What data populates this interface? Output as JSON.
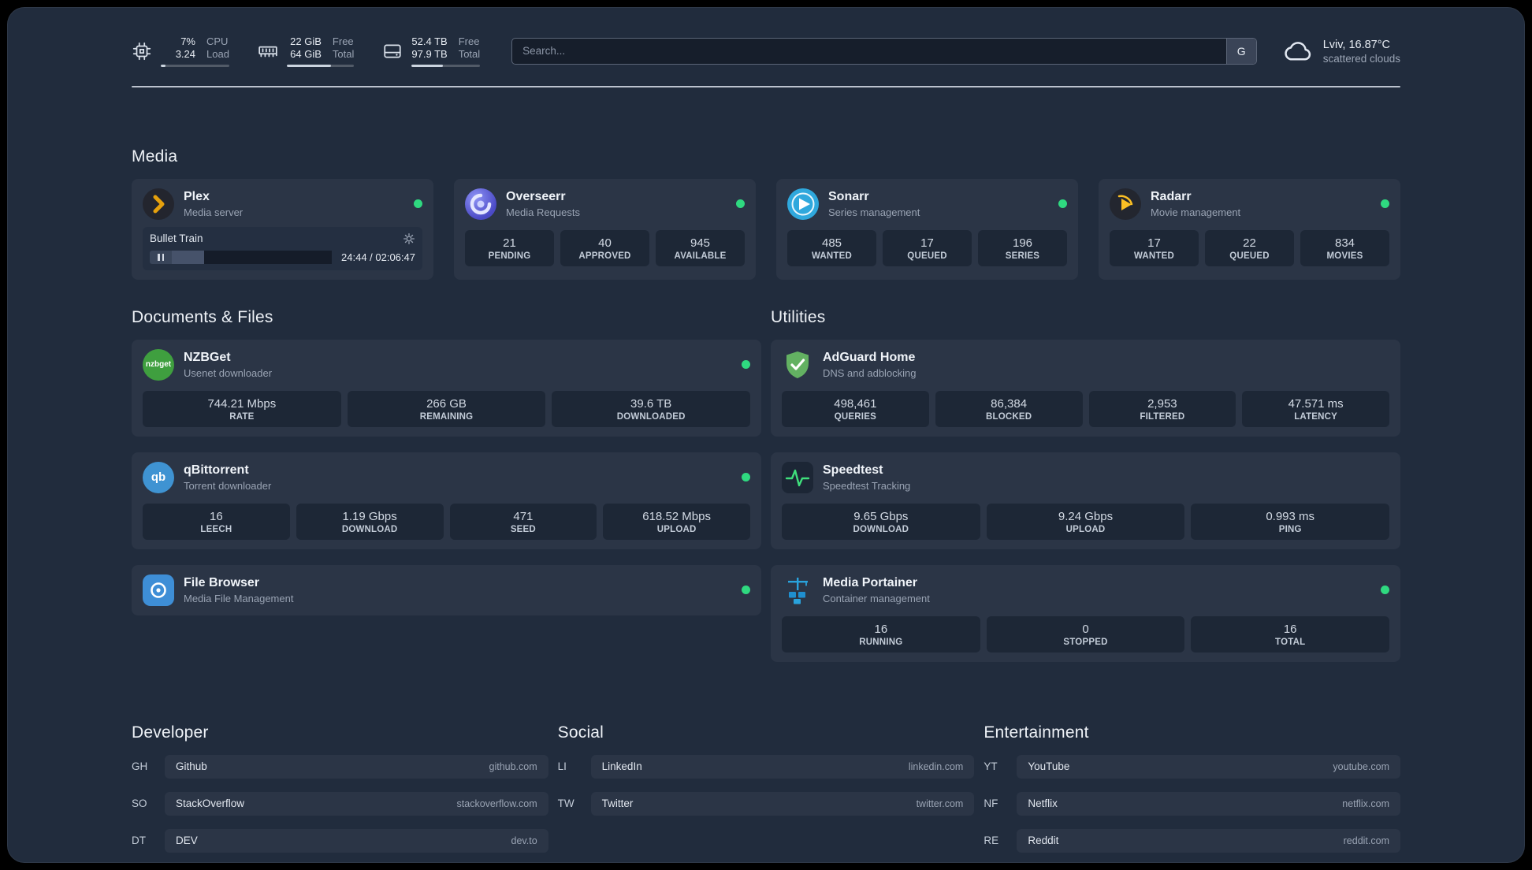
{
  "topbar": {
    "resources": [
      {
        "value_top": "7%",
        "value_bottom": "3.24",
        "label_top": "CPU",
        "label_bottom": "Load",
        "progress_pct": 7
      },
      {
        "value_top": "22 GiB",
        "value_bottom": "64 GiB",
        "label_top": "Free",
        "label_bottom": "Total",
        "progress_pct": 66
      },
      {
        "value_top": "52.4 TB",
        "value_bottom": "97.9 TB",
        "label_top": "Free",
        "label_bottom": "Total",
        "progress_pct": 46
      }
    ],
    "search": {
      "placeholder": "Search...",
      "provider": "G"
    },
    "weather": {
      "location": "Lviv, 16.87°C",
      "condition": "scattered clouds"
    }
  },
  "media": {
    "heading": "Media",
    "plex": {
      "title": "Plex",
      "subtitle": "Media server",
      "now_playing": "Bullet Train",
      "time": "24:44 / 02:06:47",
      "progress_pct": 20
    },
    "overseerr": {
      "title": "Overseerr",
      "subtitle": "Media Requests",
      "stats": [
        {
          "value": "21",
          "label": "PENDING"
        },
        {
          "value": "40",
          "label": "APPROVED"
        },
        {
          "value": "945",
          "label": "AVAILABLE"
        }
      ]
    },
    "sonarr": {
      "title": "Sonarr",
      "subtitle": "Series management",
      "stats": [
        {
          "value": "485",
          "label": "WANTED"
        },
        {
          "value": "17",
          "label": "QUEUED"
        },
        {
          "value": "196",
          "label": "SERIES"
        }
      ]
    },
    "radarr": {
      "title": "Radarr",
      "subtitle": "Movie management",
      "stats": [
        {
          "value": "17",
          "label": "WANTED"
        },
        {
          "value": "22",
          "label": "QUEUED"
        },
        {
          "value": "834",
          "label": "MOVIES"
        }
      ]
    }
  },
  "documents": {
    "heading": "Documents & Files",
    "nzbget": {
      "title": "NZBGet",
      "subtitle": "Usenet downloader",
      "icon_text": "nzbget",
      "stats": [
        {
          "value": "744.21 Mbps",
          "label": "RATE"
        },
        {
          "value": "266 GB",
          "label": "REMAINING"
        },
        {
          "value": "39.6 TB",
          "label": "DOWNLOADED"
        }
      ]
    },
    "qbittorrent": {
      "title": "qBittorrent",
      "subtitle": "Torrent downloader",
      "icon_text": "qb",
      "stats": [
        {
          "value": "16",
          "label": "LEECH"
        },
        {
          "value": "1.19 Gbps",
          "label": "DOWNLOAD"
        },
        {
          "value": "471",
          "label": "SEED"
        },
        {
          "value": "618.52 Mbps",
          "label": "UPLOAD"
        }
      ]
    },
    "filebrowser": {
      "title": "File Browser",
      "subtitle": "Media File Management"
    }
  },
  "utilities": {
    "heading": "Utilities",
    "adguard": {
      "title": "AdGuard Home",
      "subtitle": "DNS and adblocking",
      "stats": [
        {
          "value": "498,461",
          "label": "QUERIES"
        },
        {
          "value": "86,384",
          "label": "BLOCKED"
        },
        {
          "value": "2,953",
          "label": "FILTERED"
        },
        {
          "value": "47.571 ms",
          "label": "LATENCY"
        }
      ]
    },
    "speedtest": {
      "title": "Speedtest",
      "subtitle": "Speedtest Tracking",
      "stats": [
        {
          "value": "9.65 Gbps",
          "label": "DOWNLOAD"
        },
        {
          "value": "9.24 Gbps",
          "label": "UPLOAD"
        },
        {
          "value": "0.993 ms",
          "label": "PING"
        }
      ]
    },
    "portainer": {
      "title": "Media Portainer",
      "subtitle": "Container management",
      "stats": [
        {
          "value": "16",
          "label": "RUNNING"
        },
        {
          "value": "0",
          "label": "STOPPED"
        },
        {
          "value": "16",
          "label": "TOTAL"
        }
      ]
    }
  },
  "bookmarks": {
    "developer": {
      "heading": "Developer",
      "items": [
        {
          "abbr": "GH",
          "name": "Github",
          "url": "github.com"
        },
        {
          "abbr": "SO",
          "name": "StackOverflow",
          "url": "stackoverflow.com"
        },
        {
          "abbr": "DT",
          "name": "DEV",
          "url": "dev.to"
        }
      ]
    },
    "social": {
      "heading": "Social",
      "items": [
        {
          "abbr": "LI",
          "name": "LinkedIn",
          "url": "linkedin.com"
        },
        {
          "abbr": "TW",
          "name": "Twitter",
          "url": "twitter.com"
        }
      ]
    },
    "entertainment": {
      "heading": "Entertainment",
      "items": [
        {
          "abbr": "YT",
          "name": "YouTube",
          "url": "youtube.com"
        },
        {
          "abbr": "NF",
          "name": "Netflix",
          "url": "netflix.com"
        },
        {
          "abbr": "RE",
          "name": "Reddit",
          "url": "reddit.com"
        }
      ]
    }
  }
}
